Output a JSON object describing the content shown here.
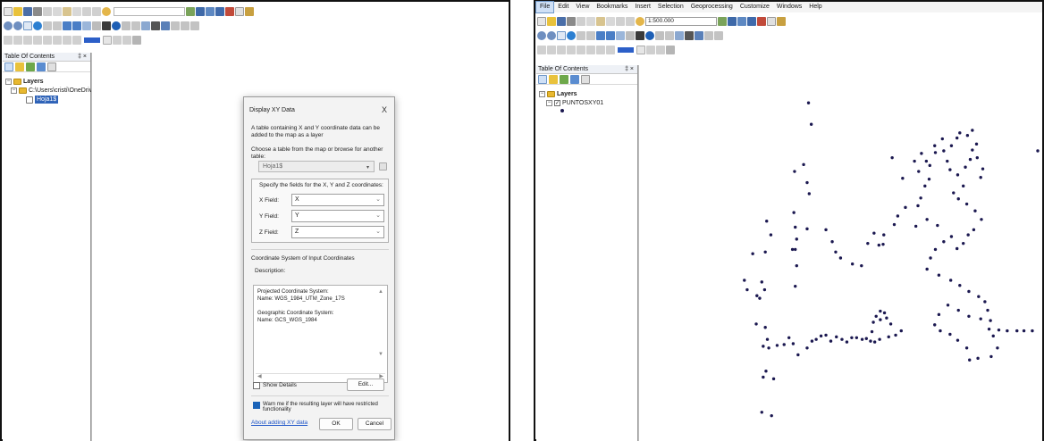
{
  "left": {
    "toc": {
      "title": "Table Of Contents",
      "pin": "‡ ×",
      "layers_label": "Layers",
      "folder_path": "C:\\Users\\cristi\\OneDrive\\",
      "table_name": "Hoja1$"
    },
    "dialog": {
      "title": "Display XY Data",
      "close": "X",
      "intro": "A table containing X and Y coordinate data can be added to the map as a layer",
      "choose_label": "Choose a table from the map or browse for another table:",
      "table_value": "Hoja1$",
      "fields_label": "Specify the fields for the X, Y and Z coordinates:",
      "x_label": "X Field:",
      "x_value": "X",
      "y_label": "Y Field:",
      "y_value": "Y",
      "z_label": "Z Field:",
      "z_value": "Z",
      "coord_section": "Coordinate System of Input Coordinates",
      "description_label": "Description:",
      "projected_heading": "Projected Coordinate System:",
      "projected_name": "Name: WGS_1984_UTM_Zone_17S",
      "geographic_heading": "Geographic Coordinate System:",
      "geographic_name": "Name: GCS_WGS_1984",
      "show_details": "Show Details",
      "edit_button": "Edit...",
      "warn_text": "Warn me if the resulting layer will have restricted functionality",
      "about_link": "About adding XY data",
      "ok_button": "OK",
      "cancel_button": "Cancel"
    }
  },
  "right": {
    "menu": [
      "File",
      "Edit",
      "View",
      "Bookmarks",
      "Insert",
      "Selection",
      "Geoprocessing",
      "Customize",
      "Windows",
      "Help"
    ],
    "scale": "1:500.000",
    "toc": {
      "title": "Table Of Contents",
      "pin": "‡ ×",
      "layers_label": "Layers",
      "layer_name": "PUNTOSXY01"
    }
  },
  "colors": {
    "point": "#1b1850",
    "accent": "#1a63b8"
  },
  "icons": [
    "new-document-icon",
    "open-folder-icon",
    "save-icon",
    "print-icon",
    "cut-icon",
    "copy-icon",
    "paste-icon",
    "delete-icon",
    "undo-icon",
    "redo-icon",
    "add-data-icon",
    "zoom-in-icon",
    "zoom-out-icon",
    "pan-icon",
    "full-extent-icon",
    "select-icon",
    "identify-icon",
    "find-icon",
    "measure-icon"
  ]
}
